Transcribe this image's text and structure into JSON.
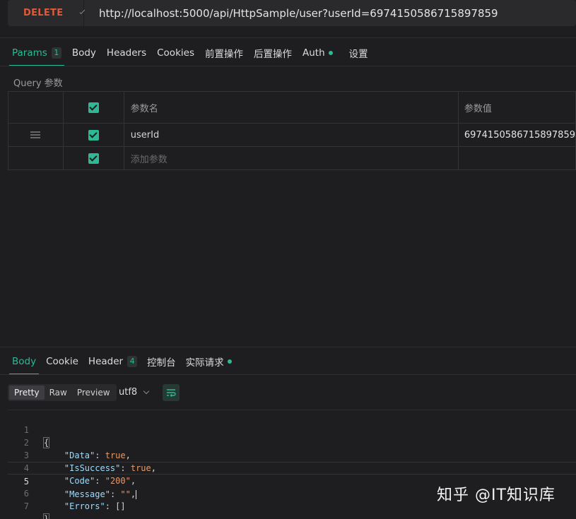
{
  "request": {
    "method": "DELETE",
    "url": "http://localhost:5000/api/HttpSample/user?userId=6974150586715897859"
  },
  "request_tabs": [
    {
      "label": "Params",
      "badge": "1"
    },
    {
      "label": "Body"
    },
    {
      "label": "Headers"
    },
    {
      "label": "Cookies"
    },
    {
      "label": "前置操作"
    },
    {
      "label": "后置操作"
    },
    {
      "label": "Auth"
    },
    {
      "label": "设置"
    }
  ],
  "query": {
    "section_label": "Query 参数",
    "headers": {
      "name": "参数名",
      "value": "参数值"
    },
    "rows": [
      {
        "name": "userId",
        "value": "6974150586715897859",
        "enabled": true
      }
    ],
    "add_placeholder": "添加参数"
  },
  "response_tabs": [
    {
      "label": "Body"
    },
    {
      "label": "Cookie"
    },
    {
      "label": "Header",
      "badge": "4"
    },
    {
      "label": "控制台"
    },
    {
      "label": "实际请求"
    }
  ],
  "view_modes": [
    "Pretty",
    "Raw",
    "Preview"
  ],
  "encoding": "utf8",
  "code_lines": [
    {
      "n": "1"
    },
    {
      "n": "2",
      "key": "\"Data\"",
      "val": "true"
    },
    {
      "n": "3",
      "key": "\"IsSuccess\"",
      "val": "true"
    },
    {
      "n": "4",
      "key": "\"Code\"",
      "val": "\"200\""
    },
    {
      "n": "5",
      "key": "\"Message\"",
      "val": "\"\""
    },
    {
      "n": "6",
      "key": "\"Errors\"",
      "val": "[]"
    },
    {
      "n": "7"
    }
  ],
  "watermark": "知乎 @IT知识库",
  "colors": {
    "accent": "#2fb895",
    "method": "#e05a3a",
    "background": "#1e1e21"
  }
}
